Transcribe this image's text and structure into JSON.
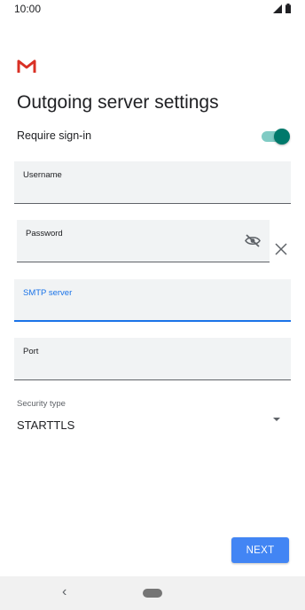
{
  "status_bar": {
    "time": "10:00"
  },
  "page": {
    "title": "Outgoing server settings"
  },
  "require_signin": {
    "label": "Require sign-in",
    "enabled": true
  },
  "fields": {
    "username": {
      "label": "Username",
      "value": ""
    },
    "password": {
      "label": "Password",
      "value": ""
    },
    "smtp_server": {
      "label": "SMTP server",
      "value": ""
    },
    "port": {
      "label": "Port",
      "value": ""
    }
  },
  "security": {
    "label": "Security type",
    "value": "STARTTLS"
  },
  "actions": {
    "next_label": "NEXT"
  },
  "nav": {
    "back_glyph": "‹"
  },
  "colors": {
    "accent": "#1a73e8",
    "button": "#4285f4",
    "toggle": "#00796b"
  },
  "icons": [
    "gmail-logo",
    "eye-off-icon",
    "clear-icon",
    "dropdown-arrow-icon",
    "signal-icon",
    "battery-icon"
  ]
}
